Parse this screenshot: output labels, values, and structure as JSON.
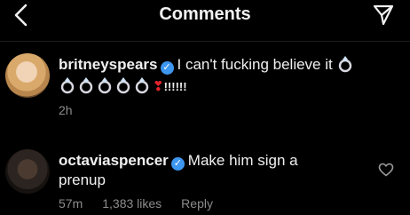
{
  "header": {
    "title": "Comments",
    "back_icon": "back-chevron-icon",
    "send_icon": "direct-send-icon"
  },
  "comments": [
    {
      "username": "britneyspears",
      "verified": true,
      "text": "I can't fucking believe it",
      "trailing": "!!!!!!",
      "ring_count": 6,
      "time": "2h"
    },
    {
      "username": "octaviaspencer",
      "verified": true,
      "text_line1": "Make him sign a",
      "text_line2": "prenup",
      "time": "57m",
      "likes": "1,383 likes",
      "reply": "Reply"
    }
  ],
  "colors": {
    "background": "#000000",
    "text": "#f0f0f0",
    "meta": "#8c8c8c",
    "verified": "#3d96ef",
    "heart": "#e0252b"
  }
}
